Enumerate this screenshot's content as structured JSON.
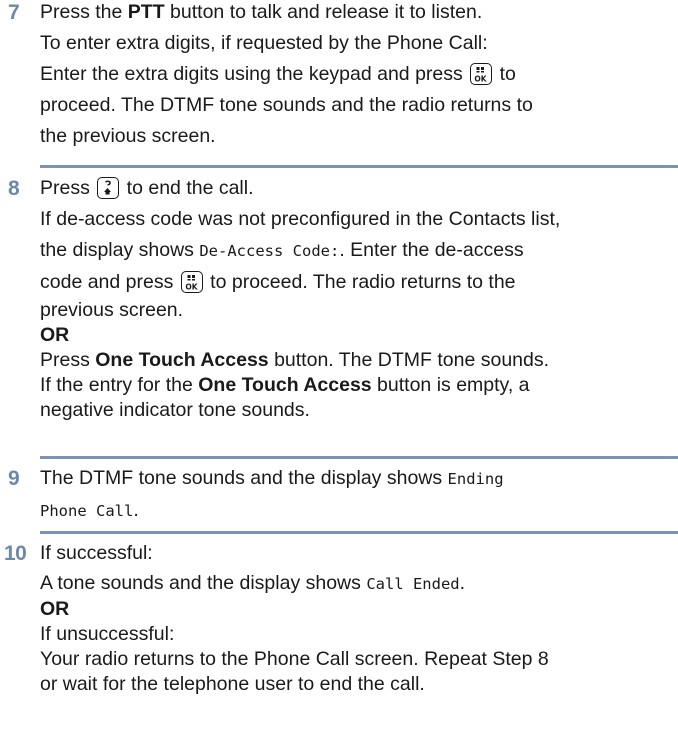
{
  "steps": [
    {
      "number": "7",
      "lines": {
        "l1_pre": "Press the ",
        "l1_b": "PTT",
        "l1_post": " button to talk and release it to listen.",
        "l2": "To enter extra digits, if requested by the Phone Call:",
        "l3_pre": "Enter the extra digits using the keypad and press ",
        "l3_post": " to",
        "l4": "proceed. The DTMF tone sounds and the radio returns to",
        "l5": "the previous screen."
      }
    },
    {
      "number": "8",
      "lines": {
        "l1_pre": "Press ",
        "l1_post": " to end the call.",
        "l2": "If de-access code was not preconfigured in the Contacts list,",
        "l3_pre": "the display shows ",
        "l3_mono": "De-Access Code:",
        "l3_post": ". Enter the de-access",
        "l4_pre": "code and press ",
        "l4_post": " to proceed. The radio returns to the",
        "l5": "previous screen.",
        "or": "OR",
        "l6_pre": "Press ",
        "l6_b": "One Touch Access",
        "l6_post": " button. The DTMF tone sounds.",
        "l7_pre": "If the entry for the ",
        "l7_b": "One Touch Access",
        "l7_post": " button is empty, a",
        "l8": "negative indicator tone sounds."
      }
    },
    {
      "number": "9",
      "lines": {
        "l1_pre": "The DTMF tone sounds and the display shows ",
        "l1_mono": "Ending",
        "l2_mono": "Phone Call",
        "l2_post": "."
      }
    },
    {
      "number": "10",
      "lines": {
        "l1": "If successful:",
        "l2_pre": "A tone sounds and the display shows ",
        "l2_mono": "Call Ended",
        "l2_post": ".",
        "or": "OR",
        "l3": "If unsuccessful:",
        "l4": "Your radio returns to the Phone Call screen. Repeat Step 8",
        "l5": "or wait for the telephone user to end the call."
      }
    }
  ],
  "icons": {
    "ok_key": "menu-ok-key-icon",
    "end_key": "back-home-key-icon"
  },
  "colors": {
    "step_number": "#6b89ad",
    "divider": "#7a92b4"
  }
}
